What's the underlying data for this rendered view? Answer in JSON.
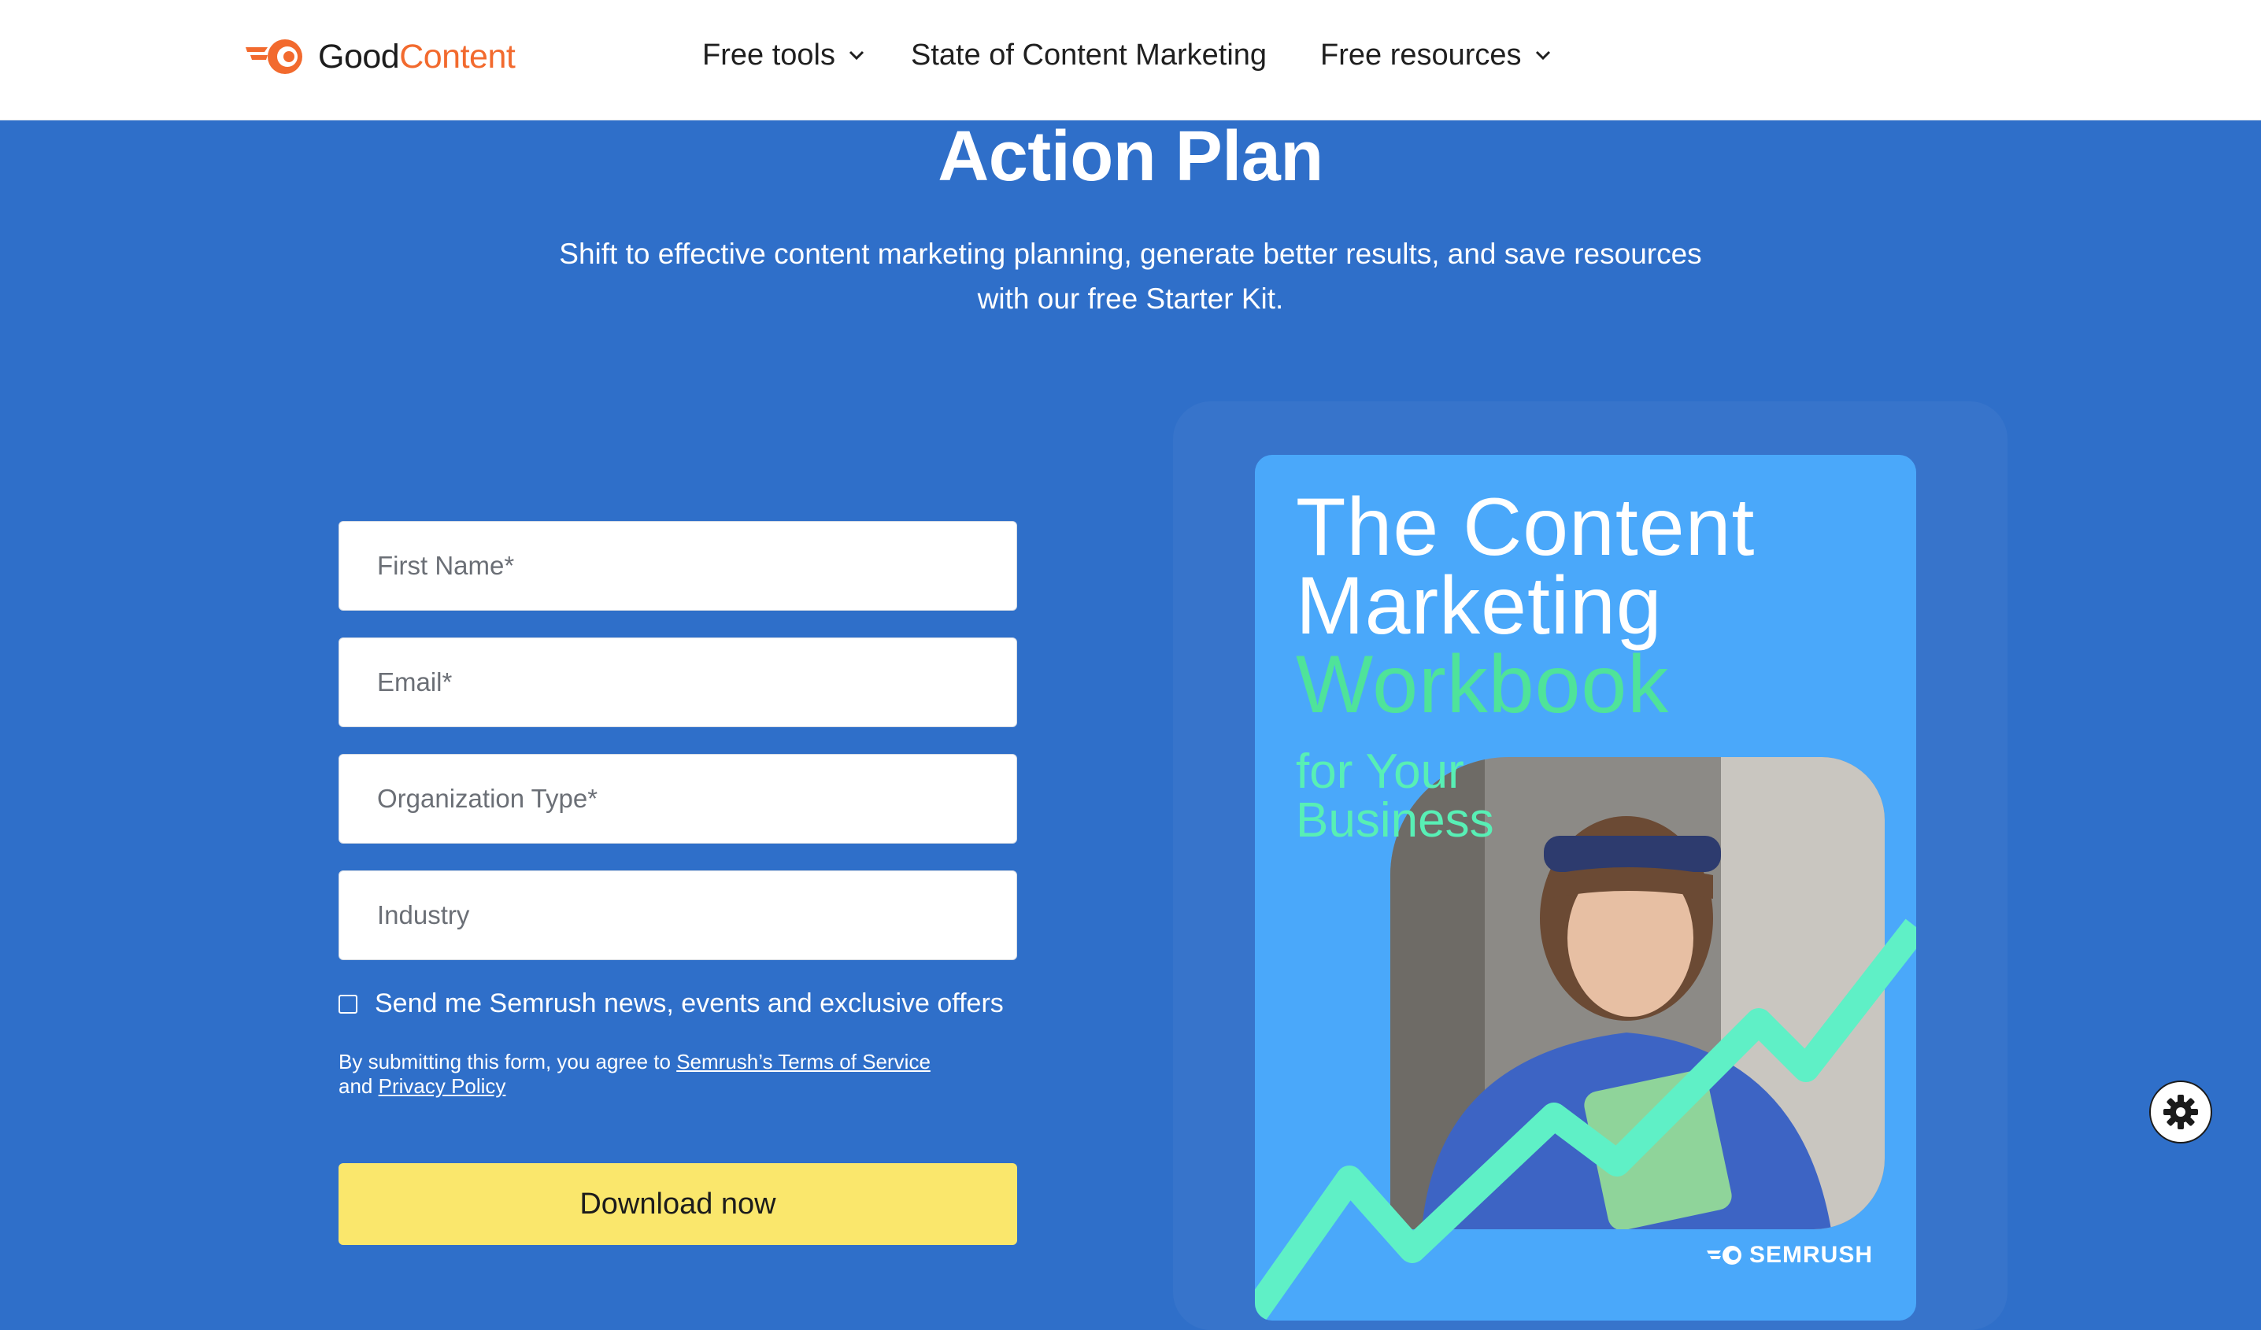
{
  "header": {
    "logo": {
      "part1": "Good",
      "part2": "Content"
    },
    "nav": [
      {
        "label": "Free tools"
      },
      {
        "label": "State of Content Marketing"
      },
      {
        "label": "Free resources"
      }
    ]
  },
  "hero": {
    "title": "Action Plan",
    "subtitle": "Shift to effective content marketing planning, generate better results, and save resources with our free Starter Kit."
  },
  "form": {
    "fields": [
      {
        "placeholder": "First Name*"
      },
      {
        "placeholder": "Email*"
      },
      {
        "placeholder": "Organization Type*"
      },
      {
        "placeholder": "Industry"
      }
    ],
    "consent_label": "Send me Semrush news, events and exclusive offers",
    "legal": {
      "prefix": "By submitting this form, you agree to ",
      "terms_link": "Semrush’s Terms of Service",
      "and": " and ",
      "privacy_link": "Privacy Policy"
    },
    "submit_label": "Download now"
  },
  "cover": {
    "line1": "The Content",
    "line2": "Marketing",
    "line3": "Workbook",
    "sub1": "for Your",
    "sub2": "Business",
    "brand": "SEMRUSH"
  },
  "colors": {
    "background": "#2f6fc9",
    "button": "#fae76c",
    "brand_orange": "#f26a2e",
    "cover_blue": "#4aa8fa",
    "cover_green": "#4fe39a"
  },
  "icons": [
    "semrush-logo-icon",
    "chevron-down-icon",
    "gear-icon"
  ]
}
